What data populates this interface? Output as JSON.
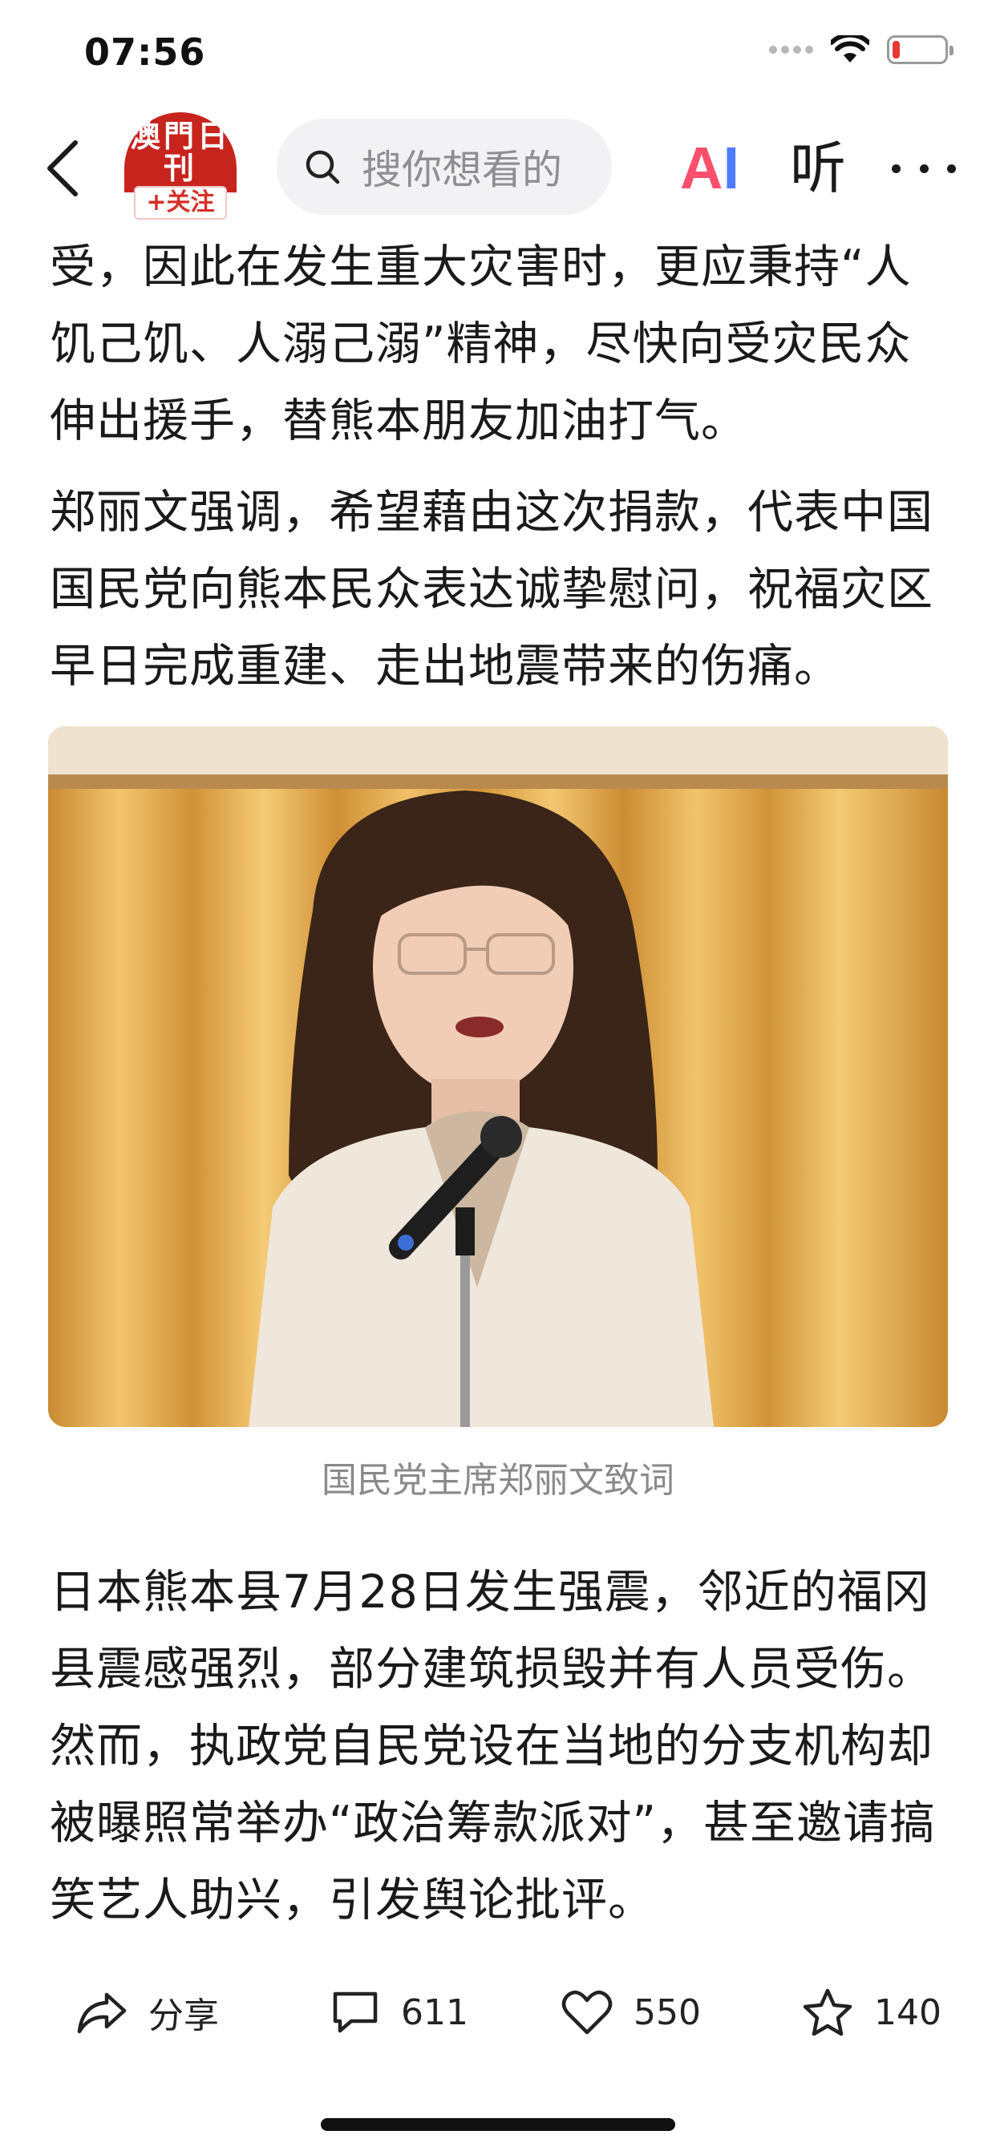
{
  "status_bar": {
    "time": "07:56",
    "battery_color": "#e53935",
    "battery_level": 0.15
  },
  "nav": {
    "logo_text": "澳門日刊",
    "follow_label": "+关注",
    "search_placeholder": "搜你想看的",
    "ai_label_a": "A",
    "ai_label_i": "I",
    "listen_label": "听"
  },
  "article": {
    "paragraphs_before": [
      "受，因此在发生重大灾害时，更应秉持“人饥己饥、人溺己溺”精神，尽快向受灾民众伸出援手，替熊本朋友加油打气。",
      "郑丽文强调，希望藉由这次捐款，代表中国国民党向熊本民众表达诚挚慰问，祝福灾区早日完成重建、走出地震带来的伤痛。"
    ],
    "image_caption": "国民党主席郑丽文致词",
    "paragraphs_after": [
      "日本熊本县7月28日发生强震，邻近的福冈县震感强烈，部分建筑损毁并有人员受伤。然而，执政党自民党设在当地的分支机构却被曝照常举办“政治筹款派对”，甚至邀请搞笑艺人助兴，引发舆论批评。"
    ]
  },
  "actions": {
    "share_label": "分享",
    "comments_count": "611",
    "likes_count": "550",
    "favorites_count": "140"
  },
  "colors": {
    "brand_red": "#c8241e",
    "follow_red": "#d6302a",
    "ai_pink": "#ff4f6d",
    "ai_blue": "#4f7dff"
  }
}
